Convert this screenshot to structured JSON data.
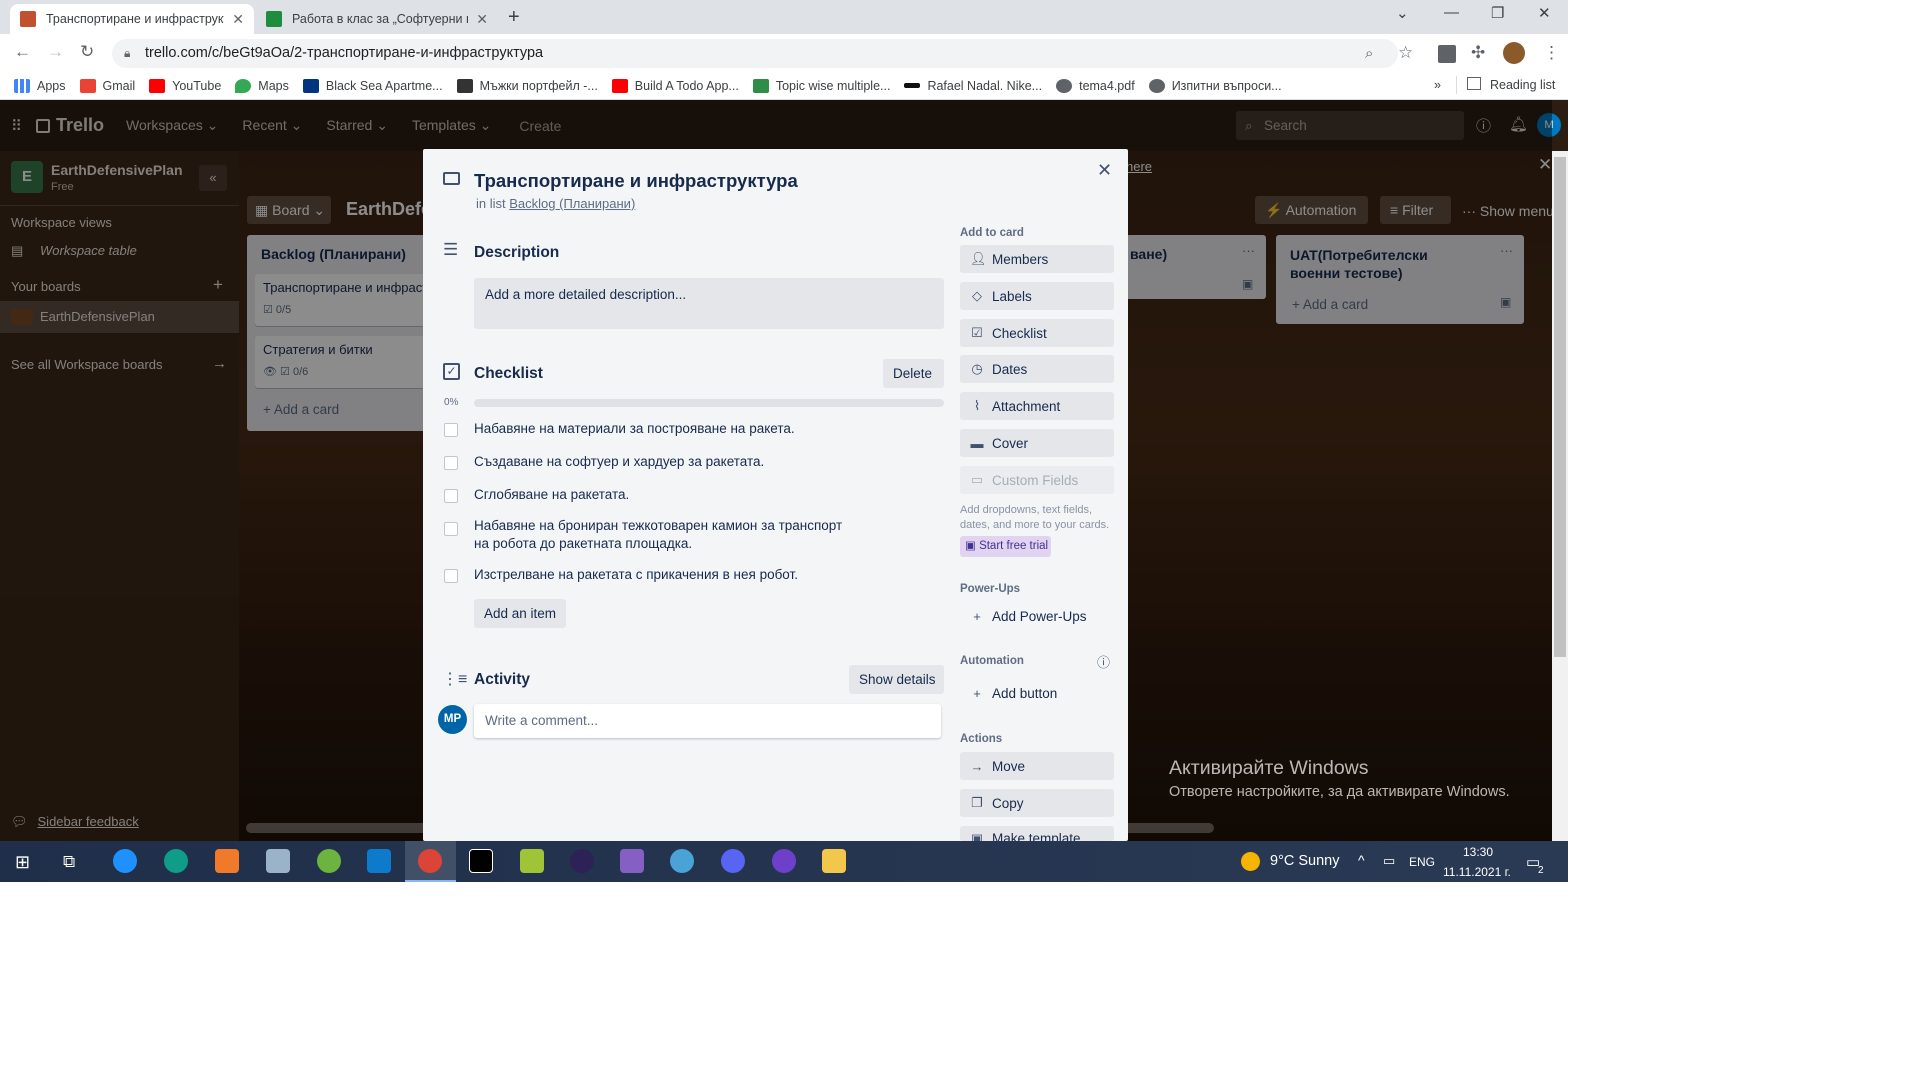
{
  "browser": {
    "tabs": [
      {
        "title": "Транспортиране и инфраструкт",
        "active": true
      },
      {
        "title": "Работа в клас за „Софтуерни пр",
        "active": false
      }
    ],
    "url": "trello.com/c/beGt9aOa/2-транспортиране-и-инфраструктура",
    "bookmarks": [
      "Apps",
      "Gmail",
      "YouTube",
      "Maps",
      "Black Sea Apartme...",
      "Мъжки портфейл -...",
      "Build A Todo App...",
      "Topic wise multiple...",
      "Rafael Nadal. Nike...",
      "tema4.pdf",
      "Изпитни въпроси..."
    ],
    "more": "»",
    "reading_list": "Reading list"
  },
  "trello_nav": {
    "logo": "Trello",
    "items": [
      "Workspaces",
      "Recent",
      "Starred",
      "Templates"
    ],
    "create": "Create",
    "search_placeholder": "Search",
    "avatar": "M"
  },
  "sidebar": {
    "workspace_initial": "E",
    "workspace_name": "EarthDefensivePlan",
    "workspace_plan": "Free",
    "views_heading": "Workspace views",
    "workspace_table": "Workspace table",
    "boards_heading": "Your boards",
    "board_name": "EarthDefensivePlan",
    "see_all": "See all Workspace boards",
    "feedback": "Sidebar feedback"
  },
  "board": {
    "view_button": "Board",
    "name": "EarthDefe",
    "automation": "Automation",
    "filter": "Filter",
    "show_menu": "Show menu",
    "banner_link": "here",
    "lists": [
      {
        "title": "Backlog (Планирани)",
        "cards": [
          {
            "title": "Транспортиране и инфраст",
            "badge": "0/5"
          },
          {
            "title": "Стратегия и битки",
            "badge": "0/6"
          }
        ],
        "add": "Add a card"
      },
      {
        "title": "ване)",
        "add": ""
      },
      {
        "title": "UAT(Потребителски военни тестове)",
        "add": "Add a card"
      }
    ]
  },
  "card_modal": {
    "title": "Транспортиране и инфраструктура",
    "in_list_prefix": "in list",
    "list_name": "Backlog (Планирани)",
    "description": {
      "heading": "Description",
      "placeholder": "Add a more detailed description..."
    },
    "checklist": {
      "heading": "Checklist",
      "delete": "Delete",
      "progress_label": "0%",
      "progress": 0,
      "items": [
        "Набавяне на материали за построяване на ракета.",
        "Създаване на софтуер и хардуер за ракетата.",
        "Сглобяване на ракетата.",
        "Набавяне на брониран тежкотоварен камион за транспорт на робота до ракетната площадка.",
        "Изстрелване на ракетата с прикачения в нея робот."
      ],
      "add_item": "Add an item"
    },
    "activity": {
      "heading": "Activity",
      "show_details": "Show details",
      "avatar": "MP",
      "comment_placeholder": "Write a comment..."
    },
    "sidebar": {
      "add_to_card": "Add to card",
      "buttons": [
        "Members",
        "Labels",
        "Checklist",
        "Dates",
        "Attachment",
        "Cover",
        "Custom Fields"
      ],
      "custom_fields_hint": "Add dropdowns, text fields, dates, and more to your cards.",
      "trial": "Start free trial",
      "powerups_heading": "Power-Ups",
      "add_powerups": "Add Power-Ups",
      "automation_heading": "Automation",
      "add_button": "Add button",
      "actions_heading": "Actions",
      "actions": [
        "Move",
        "Copy",
        "Make template"
      ]
    }
  },
  "windows_watermark": {
    "title": "Активирайте Windows",
    "subtitle": "Отворете настройките, за да активирате Windows."
  },
  "taskbar": {
    "weather": "9°C  Sunny",
    "lang": "ENG",
    "time": "13:30",
    "date": "11.11.2021 г.",
    "notif": "2"
  }
}
